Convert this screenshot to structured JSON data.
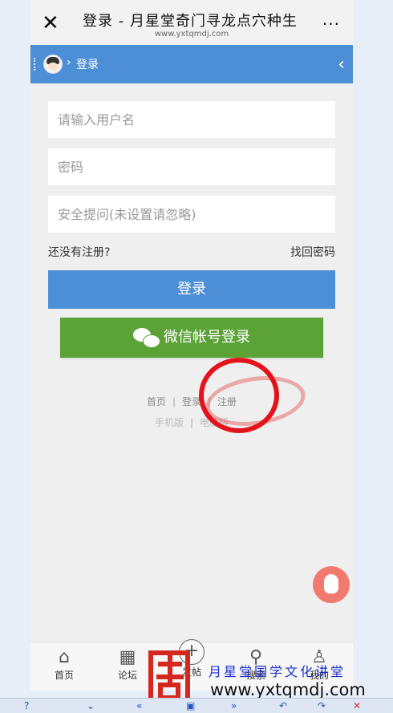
{
  "header": {
    "close_icon": "close-icon",
    "title": "登录 - 月星堂奇门寻龙点穴种生",
    "domain": "www.yxtqmdj.com",
    "more_label": "..."
  },
  "breadcrumb": {
    "separator": "›",
    "current": "登录",
    "back_icon": "chevron-left-icon"
  },
  "form": {
    "username_placeholder": "请输入用户名",
    "password_placeholder": "密码",
    "security_placeholder": "安全提问(未设置请忽略)",
    "register_prompt": "还没有注册?",
    "forgot_password": "找回密码",
    "login_button": "登录",
    "wechat_button": "微信帐号登录"
  },
  "footer": {
    "links_row1": [
      "首页",
      "登录",
      "注册"
    ],
    "links_row2": [
      "手机版",
      "电脑版"
    ],
    "separator": "|"
  },
  "tabbar": {
    "items": [
      {
        "label": "首页",
        "icon": "home-icon"
      },
      {
        "label": "论坛",
        "icon": "grid-icon"
      },
      {
        "label": "发帖",
        "icon": "plus-circle-icon"
      },
      {
        "label": "搜索",
        "icon": "search-icon"
      },
      {
        "label": "我的",
        "icon": "user-icon"
      }
    ]
  },
  "watermark": {
    "line1": "月星堂国学文化讲堂",
    "line2": "www.yxtqmdj.com"
  },
  "colors": {
    "brand_blue": "#4d8fd7",
    "wechat_green": "#5ba337",
    "annotation_red": "#e4131b",
    "qq_button": "#f07a6d"
  }
}
